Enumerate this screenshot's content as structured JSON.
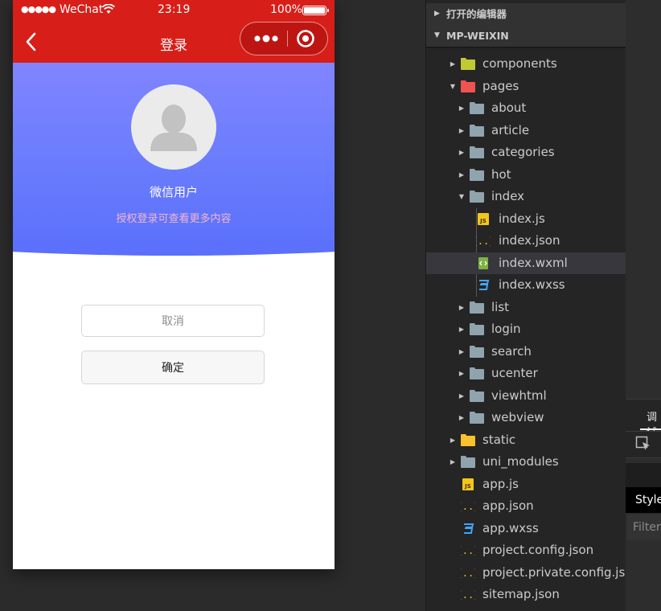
{
  "statusbar": {
    "signal": "●●●●●",
    "carrier": "WeChat",
    "time": "23:19",
    "battery": "100%"
  },
  "navbar": {
    "title": "登录"
  },
  "profile": {
    "username": "微信用户",
    "hint": "授权登录可查看更多内容"
  },
  "buttons": {
    "cancel": "取消",
    "confirm": "确定"
  },
  "colors": {
    "nav_red": "#d81e18",
    "hero_top": "#8184fe",
    "hero_bottom": "#5a6ffb",
    "hint_pink": "#f4b6ce"
  },
  "explorer": {
    "open_editors": "打开的编辑器",
    "project": "MP-WEIXIN",
    "tree": [
      {
        "name": "components",
        "type": "folder-components",
        "depth": 0,
        "expanded": false
      },
      {
        "name": "pages",
        "type": "folder-pages",
        "depth": 0,
        "expanded": true
      },
      {
        "name": "about",
        "type": "folder",
        "depth": 1,
        "expanded": false
      },
      {
        "name": "article",
        "type": "folder",
        "depth": 1,
        "expanded": false
      },
      {
        "name": "categories",
        "type": "folder",
        "depth": 1,
        "expanded": false
      },
      {
        "name": "hot",
        "type": "folder",
        "depth": 1,
        "expanded": false
      },
      {
        "name": "index",
        "type": "folder-open",
        "depth": 1,
        "expanded": true
      },
      {
        "name": "index.js",
        "type": "js",
        "depth": 2
      },
      {
        "name": "index.json",
        "type": "json",
        "depth": 2
      },
      {
        "name": "index.wxml",
        "type": "wxml",
        "depth": 2,
        "selected": true
      },
      {
        "name": "index.wxss",
        "type": "css",
        "depth": 2
      },
      {
        "name": "list",
        "type": "folder",
        "depth": 1,
        "expanded": false
      },
      {
        "name": "login",
        "type": "folder",
        "depth": 1,
        "expanded": false
      },
      {
        "name": "search",
        "type": "folder",
        "depth": 1,
        "expanded": false
      },
      {
        "name": "ucenter",
        "type": "folder",
        "depth": 1,
        "expanded": false
      },
      {
        "name": "viewhtml",
        "type": "folder",
        "depth": 1,
        "expanded": false
      },
      {
        "name": "webview",
        "type": "folder",
        "depth": 1,
        "expanded": false
      },
      {
        "name": "static",
        "type": "folder-static",
        "depth": 0,
        "expanded": false
      },
      {
        "name": "uni_modules",
        "type": "folder",
        "depth": 0,
        "expanded": false
      },
      {
        "name": "app.js",
        "type": "js",
        "depth": 0
      },
      {
        "name": "app.json",
        "type": "json",
        "depth": 0
      },
      {
        "name": "app.wxss",
        "type": "css",
        "depth": 0
      },
      {
        "name": "project.config.json",
        "type": "json",
        "depth": 0
      },
      {
        "name": "project.private.config.js...",
        "type": "json",
        "depth": 0
      },
      {
        "name": "sitemap.json",
        "type": "json",
        "depth": 0
      }
    ]
  },
  "devtools": {
    "tab": "调试",
    "styles_tab": "Styles",
    "filter_placeholder": "Filter"
  }
}
